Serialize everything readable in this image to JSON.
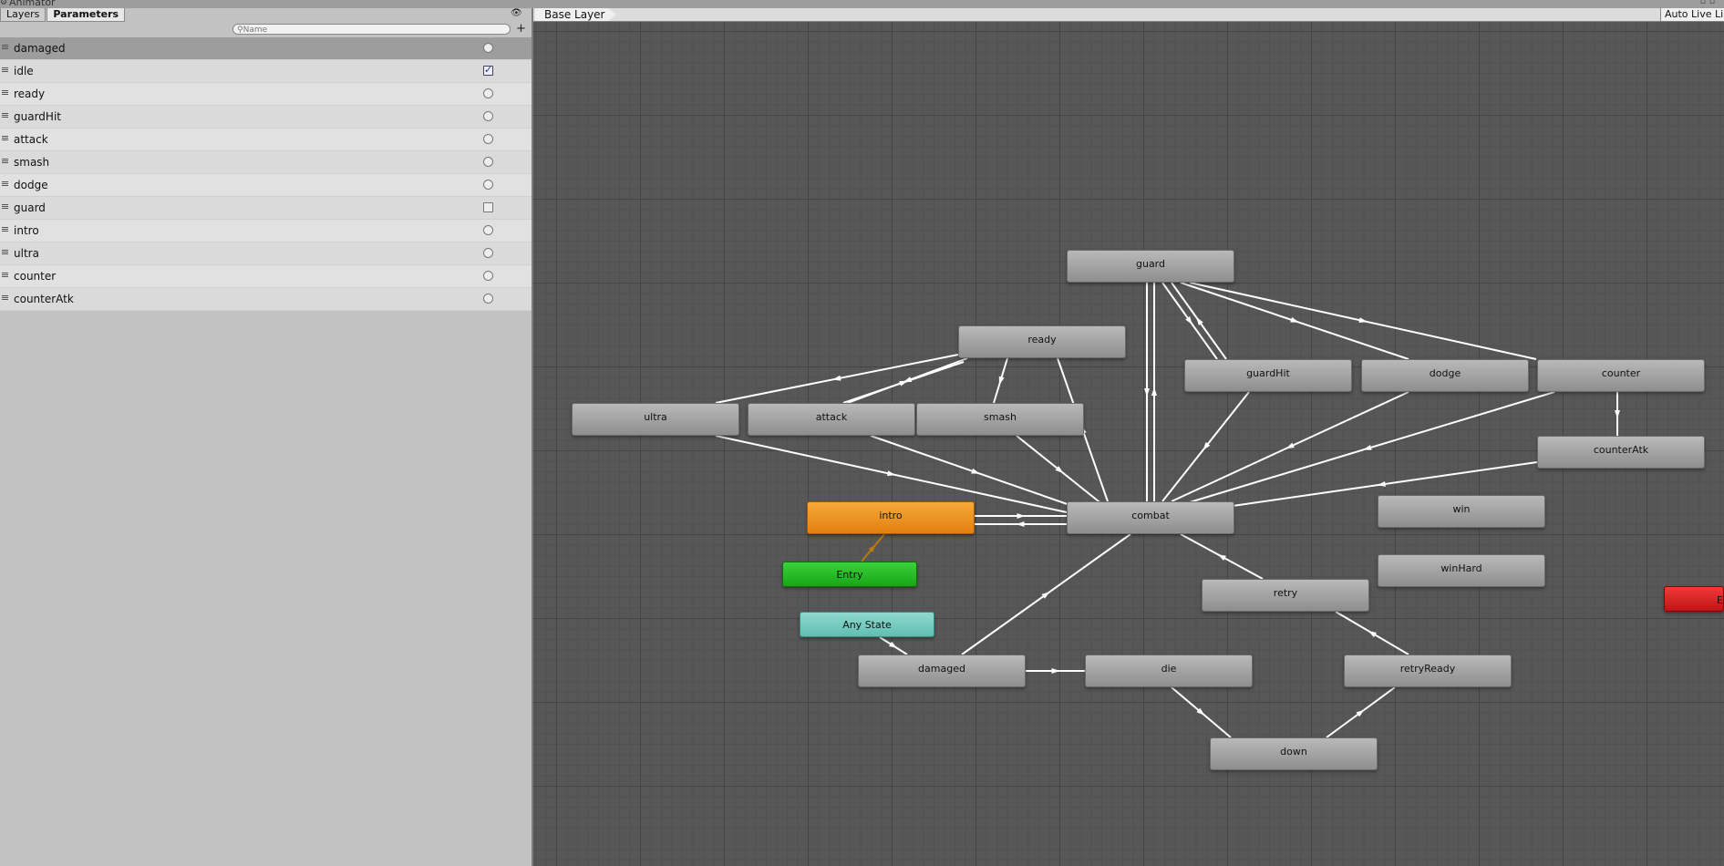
{
  "window": {
    "title": "Animator"
  },
  "tabs": {
    "layers": "Layers",
    "parameters": "Parameters"
  },
  "search": {
    "placeholder": "Name"
  },
  "parameters": [
    {
      "name": "damaged",
      "type": "trigger",
      "value": false,
      "selected": true
    },
    {
      "name": "idle",
      "type": "bool",
      "value": true
    },
    {
      "name": "ready",
      "type": "trigger",
      "value": false
    },
    {
      "name": "guardHit",
      "type": "trigger",
      "value": false
    },
    {
      "name": "attack",
      "type": "trigger",
      "value": false
    },
    {
      "name": "smash",
      "type": "trigger",
      "value": false
    },
    {
      "name": "dodge",
      "type": "trigger",
      "value": false
    },
    {
      "name": "guard",
      "type": "bool",
      "value": false
    },
    {
      "name": "intro",
      "type": "trigger",
      "value": false
    },
    {
      "name": "ultra",
      "type": "trigger",
      "value": false
    },
    {
      "name": "counter",
      "type": "trigger",
      "value": false
    },
    {
      "name": "counterAtk",
      "type": "trigger",
      "value": false
    }
  ],
  "graph": {
    "breadcrumb": "Base Layer",
    "auto_live_link": "Auto Live Li",
    "states": {
      "guard": "guard",
      "ready": "ready",
      "guardHit": "guardHit",
      "dodge": "dodge",
      "counter": "counter",
      "ultra": "ultra",
      "attack": "attack",
      "smash": "smash",
      "counterAtk": "counterAtk",
      "intro": "intro",
      "combat": "combat",
      "win": "win",
      "entry": "Entry",
      "winHard": "winHard",
      "retry": "retry",
      "any_state": "Any State",
      "damaged": "damaged",
      "die": "die",
      "retryReady": "retryReady",
      "down": "down",
      "exit": "E"
    }
  },
  "colors": {
    "default_state": "#a3a3a3",
    "default_entry_state": "#e8900f",
    "entry": "#1fb81f",
    "any_state": "#74ccc0",
    "exit": "#d81e1e",
    "transition": "#ffffff",
    "entry_transition": "#b97a10"
  }
}
